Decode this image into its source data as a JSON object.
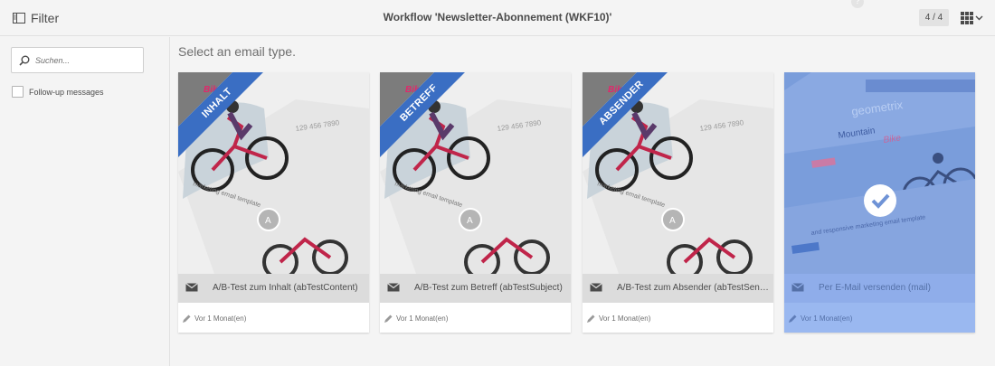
{
  "header": {
    "filter_label": "Filter",
    "title": "Workflow 'Newsletter-Abonnement (WKF10)'",
    "help_icon": "question-icon",
    "counter": "4 / 4",
    "view_icon": "grid-view-icon"
  },
  "sidebar": {
    "search": {
      "placeholder": "Suchen...",
      "value": ""
    },
    "followup_label": "Follow-up messages",
    "followup_checked": false
  },
  "main": {
    "heading": "Select an email type.",
    "cards": [
      {
        "ribbon": "INHALT",
        "title": "A/B-Test zum Inhalt (abTestContent)",
        "date": "Vor 1 Monat(en)",
        "selected": false
      },
      {
        "ribbon": "BETREFF",
        "title": "A/B-Test zum Betreff (abTestSubject)",
        "date": "Vor 1 Monat(en)",
        "selected": false
      },
      {
        "ribbon": "ABSENDER",
        "title": "A/B-Test zum Absender (abTestSende…",
        "date": "Vor 1 Monat(en)",
        "selected": false
      },
      {
        "ribbon": "",
        "title": "Per E-Mail versenden (mail)",
        "date": "Vor 1 Monat(en)",
        "selected": true
      }
    ]
  },
  "thumbnail_text": {
    "bike": "Bike",
    "phone": "129 456 7890",
    "tagline": "marketing email template",
    "brand": "geometrix",
    "mountain": "Mountain",
    "selected_tagline": "and responsive marketing email template"
  },
  "colors": {
    "accent": "#3a6ec3",
    "selected_overlay": "#6f93d6",
    "background": "#f4f4f4"
  }
}
